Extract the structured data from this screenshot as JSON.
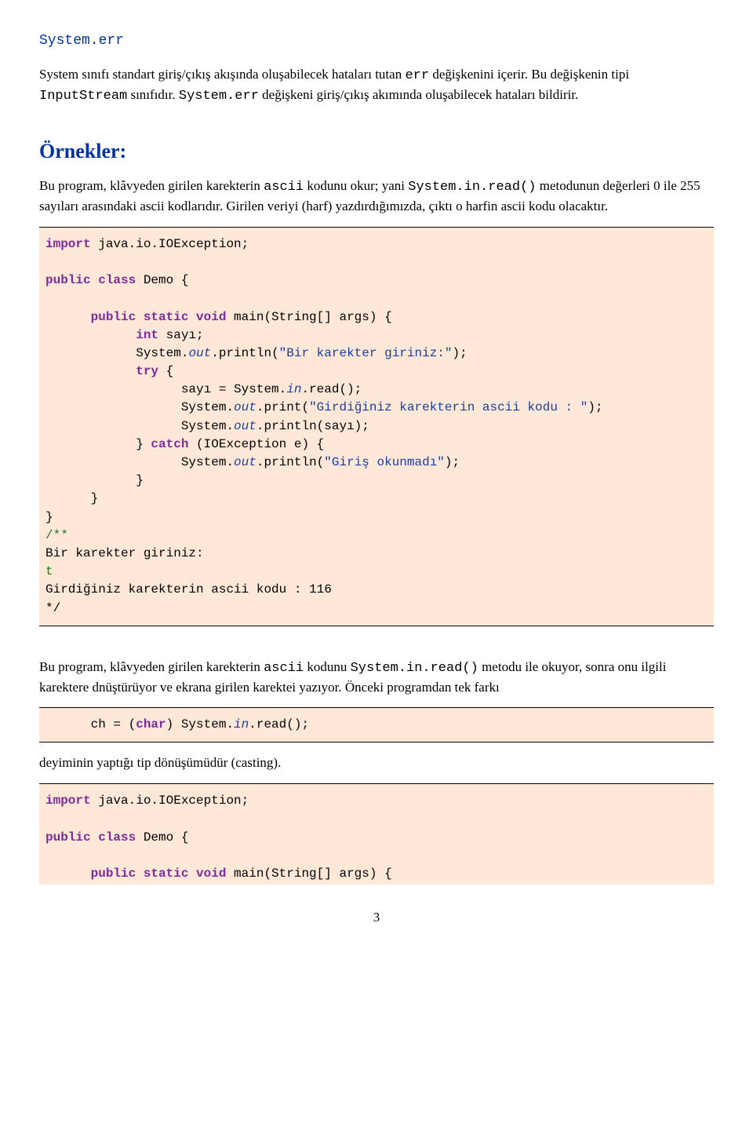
{
  "heading": "System.err",
  "para1_prefix": "System sınıfı standart giriş/çıkış akışında oluşabilecek hataları tutan ",
  "para1_code1": "err",
  "para1_mid1": " değişkenini içerir. Bu değişkenin tipi ",
  "para1_code2": "InputStream",
  "para1_mid2": " sınıfıdır. ",
  "para1_code3": "System.err",
  "para1_tail": " değişkeni giriş/çıkış akımında oluşabilecek hataları bildirir.",
  "examples_title": "Örnekler:",
  "para2_a": "Bu program, klâvyeden girilen karekterin ",
  "para2_code1": "ascii",
  "para2_b": " kodunu okur; yani ",
  "para2_code2": "System.in.read()",
  "para2_c": " metodunun değerleri 0 ile 255 sayıları arasındaki ascii kodlarıdır. Girilen veriyi (harf) yazdırdığımızda, çıktı o harfin ascii kodu olacaktır.",
  "code1": {
    "l1a": "import",
    "l1b": " java.io.IOException;",
    "l2a": "public class",
    "l2b": " Demo {",
    "l3a": "public static void",
    "l3b": " main(String[] args) {",
    "l4a": "int",
    "l4b": " sayı;",
    "l5a": "System.",
    "l5b": "out",
    "l5c": ".println(",
    "l5d": "\"Bir karekter giriniz:\"",
    "l5e": ");",
    "l6a": "try",
    "l6b": " {",
    "l7a": "sayı = System.",
    "l7b": "in",
    "l7c": ".read();",
    "l8a": "System.",
    "l8b": "out",
    "l8c": ".print(",
    "l8d": "\"Girdiğiniz karekterin ascii kodu : \"",
    "l8e": ");",
    "l9a": "System.",
    "l9b": "out",
    "l9c": ".println(sayı);",
    "l10a": "} ",
    "l10b": "catch",
    "l10c": " (IOException e) {",
    "l11a": "System.",
    "l11b": "out",
    "l11c": ".println(",
    "l11d": "\"Giriş okunmadı\"",
    "l11e": ");",
    "c1": "/**",
    "c2": "Bir karekter giriniz:",
    "c3": "t",
    "c4": "Girdiğiniz karekterin ascii kodu : 116",
    "c5": "*/"
  },
  "para3_a": "Bu program, klâvyeden girilen karekterin ",
  "para3_code1": "ascii",
  "para3_b": " kodunu ",
  "para3_code2": "System.in.read()",
  "para3_c": " metodu ile okuyor, sonra onu ilgili karektere dnüştürüyor ve ekrana girilen karektei yazıyor. Önceki programdan tek farkı",
  "code2": {
    "l1a": "ch = (",
    "l1b": "char",
    "l1c": ") System.",
    "l1d": "in",
    "l1e": ".read();"
  },
  "para4": "deyiminin yaptığı tip dönüşümüdür (casting).",
  "code3": {
    "l1a": "import",
    "l1b": " java.io.IOException;",
    "l2a": "public class",
    "l2b": " Demo {",
    "l3a": "public static void",
    "l3b": " main(String[] args) {"
  },
  "page_number": "3"
}
